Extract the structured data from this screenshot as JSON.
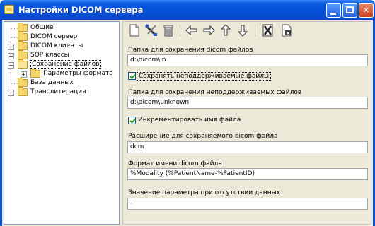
{
  "window": {
    "title": "Настройки DICOM сервера",
    "controls": {
      "minimize": "_",
      "maximize": "□",
      "close": "✕"
    }
  },
  "tree": {
    "items": [
      {
        "label": "Общие",
        "level": 0,
        "expandable": false,
        "selected": false
      },
      {
        "label": "DICOM сервер",
        "level": 0,
        "expandable": false,
        "selected": false
      },
      {
        "label": "DICOM клиенты",
        "level": 0,
        "expandable": true,
        "selected": false
      },
      {
        "label": "SOP классы",
        "level": 0,
        "expandable": true,
        "selected": false
      },
      {
        "label": "Сохранение файлов",
        "level": 0,
        "expandable": true,
        "expanded": true,
        "selected": true
      },
      {
        "label": "Параметры формата",
        "level": 1,
        "expandable": true,
        "selected": false
      },
      {
        "label": "База данных",
        "level": 0,
        "expandable": false,
        "selected": false
      },
      {
        "label": "Транслитерация",
        "level": 0,
        "expandable": true,
        "selected": false
      }
    ]
  },
  "toolbar": {
    "buttons": [
      "new-document-icon",
      "tools-icon",
      "delete-icon",
      "arrow-left-icon",
      "arrow-right-icon",
      "arrow-up-icon",
      "arrow-down-icon",
      "cancel-icon",
      "export-icon"
    ]
  },
  "form": {
    "dicom_folder_label": "Папка для сохранения dicom файлов",
    "dicom_folder_value": "d:\\dicom\\in",
    "save_unsupported_label": "Сохранять неподдерживаемые файлы",
    "save_unsupported_checked": true,
    "unsupported_folder_label": "Папка для сохранения неподдерживаемых файлов",
    "unsupported_folder_value": "d:\\dicom\\unknown",
    "increment_name_label": "Инкрементировать имя файла",
    "increment_name_checked": true,
    "extension_label": "Расширение для сохраняемого dicom файла",
    "extension_value": "dcm",
    "name_format_label": "Формат имени dicom файла",
    "name_format_value": "%Modality (%PatientName-%PatientID)",
    "missing_value_label": "Значение параметра при отсутствии данных",
    "missing_value_value": "-"
  },
  "colors": {
    "titlebar": "#0550d8",
    "face": "#ece9d8",
    "folder": "#f6d66b",
    "check": "#21a121"
  }
}
